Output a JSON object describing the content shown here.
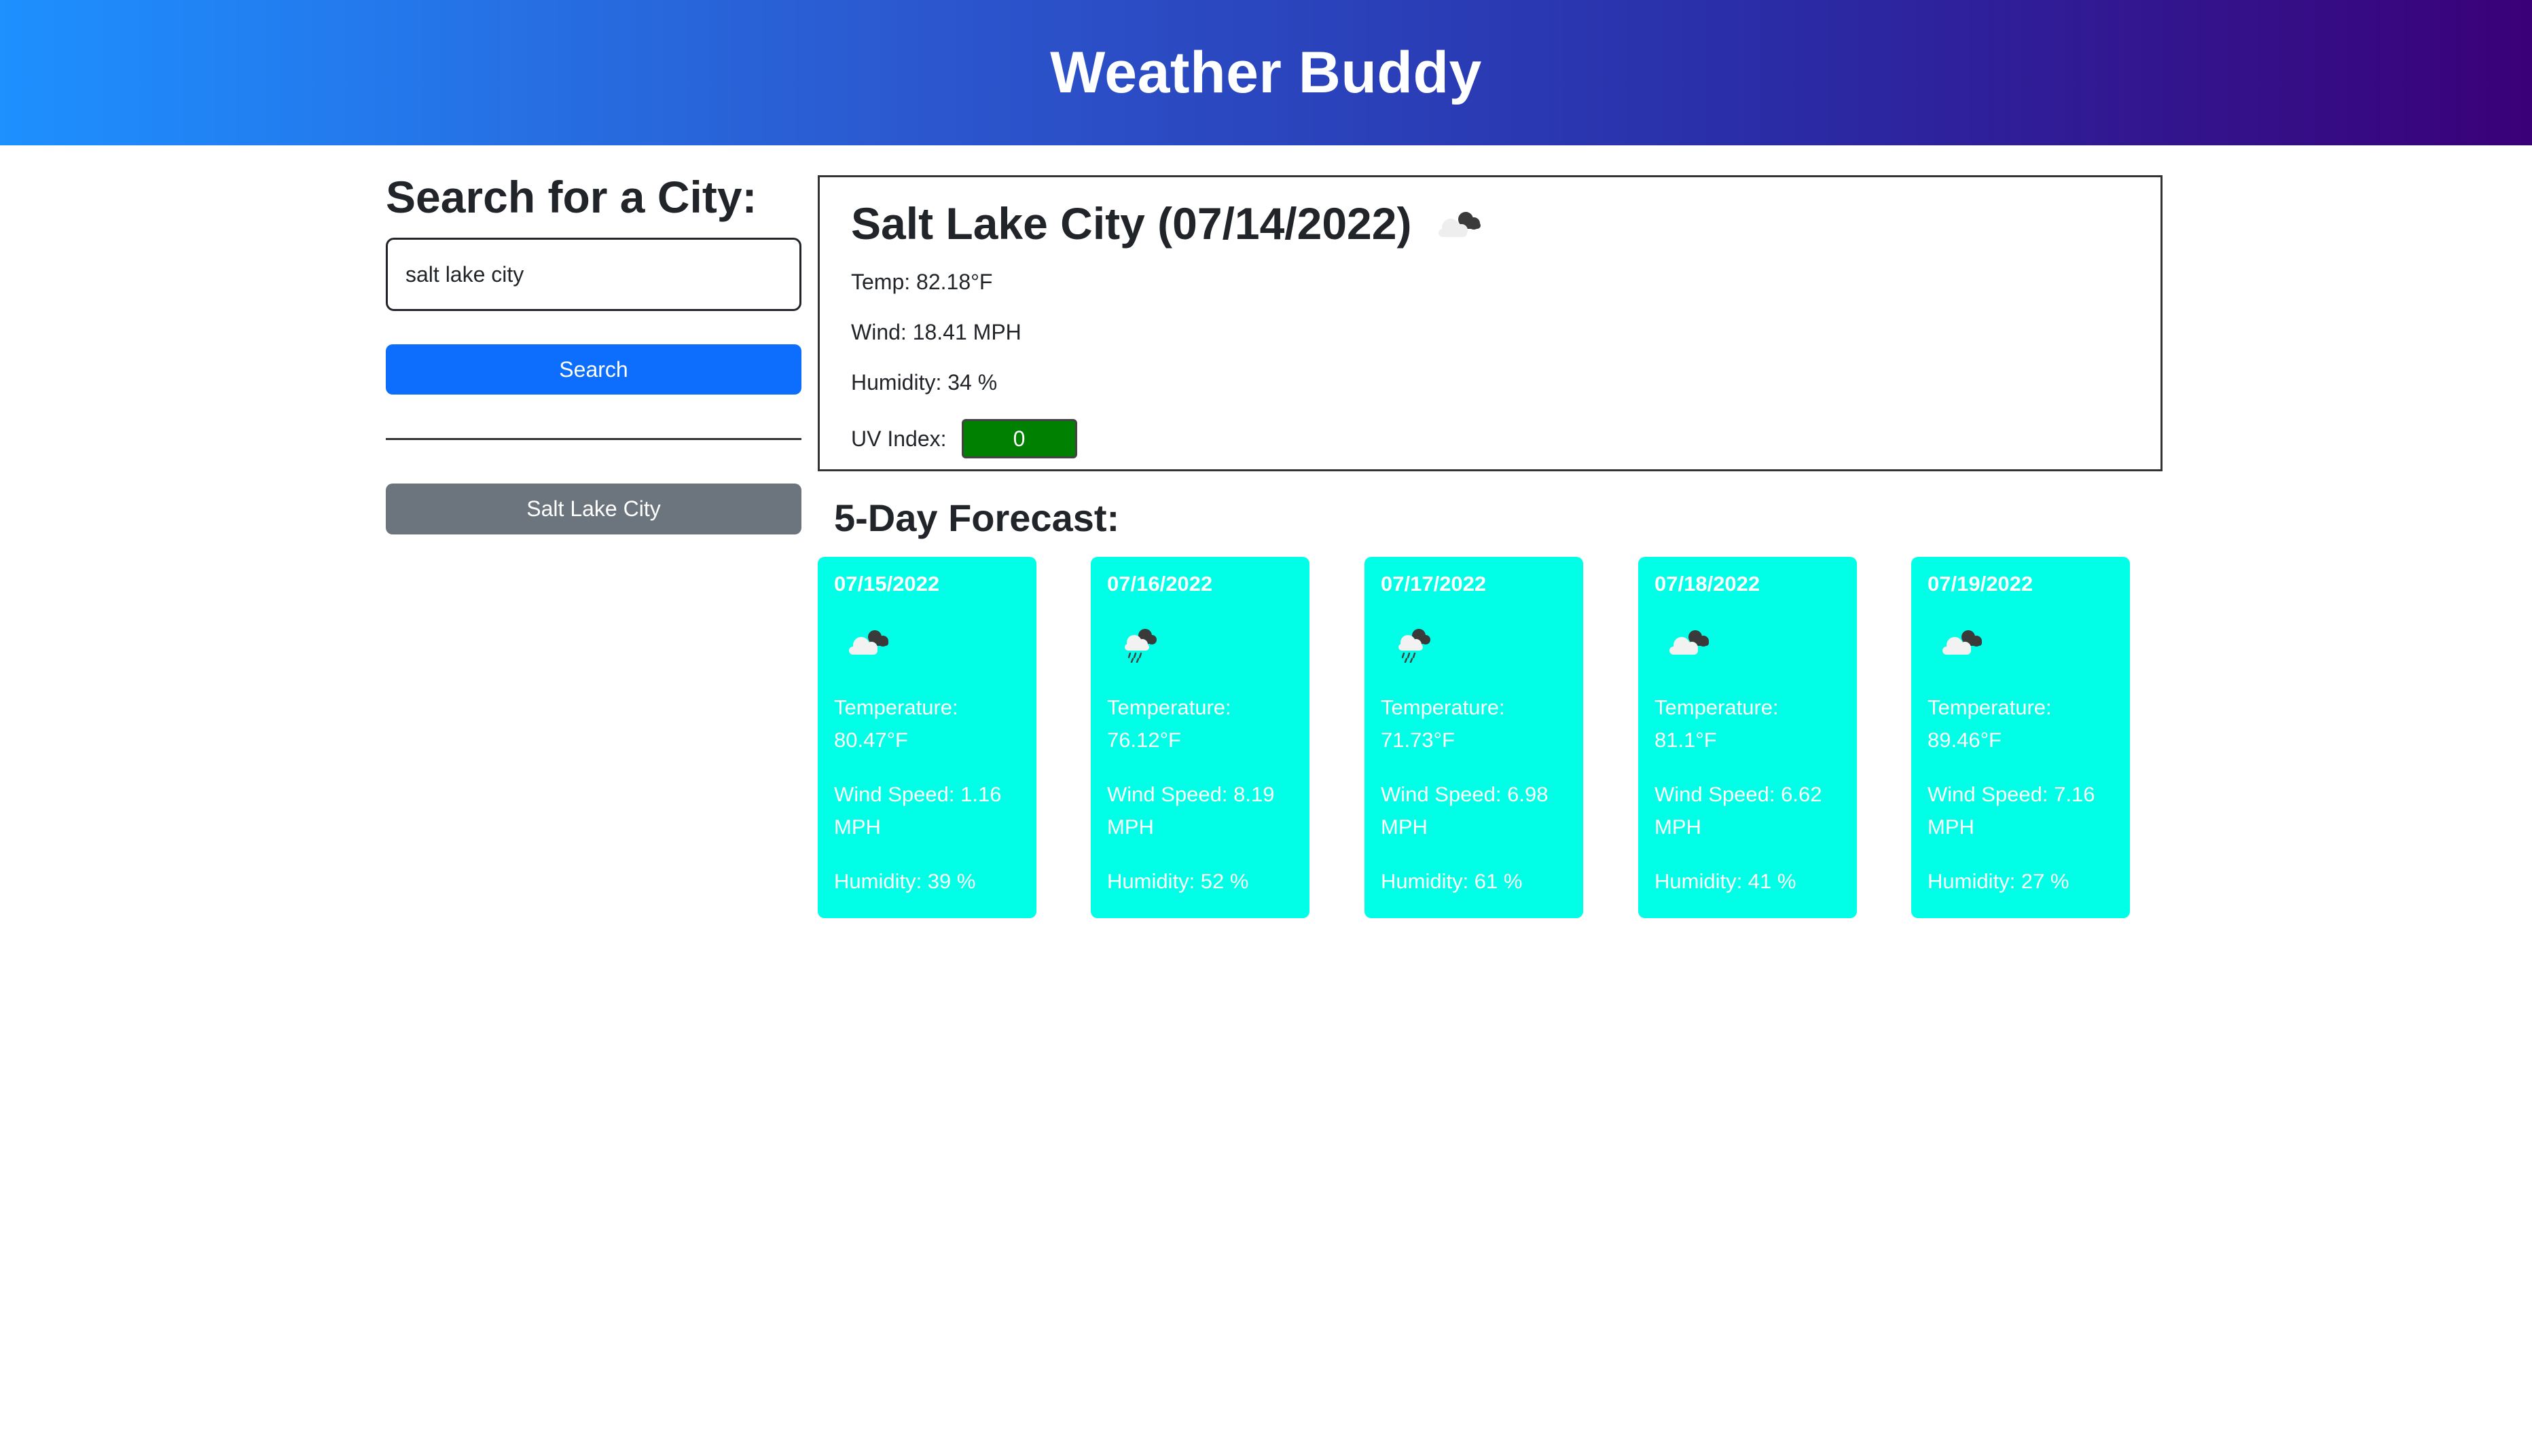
{
  "app": {
    "title": "Weather Buddy"
  },
  "search": {
    "title": "Search for a City:",
    "input_value": "salt lake city",
    "button_label": "Search"
  },
  "history": [
    "Salt Lake City"
  ],
  "current": {
    "title": "Salt Lake City (07/14/2022)",
    "icon": "cloudy-icon",
    "temp": "Temp: 82.18°F",
    "wind": "Wind: 18.41 MPH",
    "humidity": "Humidity: 34 %",
    "uv_label": "UV Index:",
    "uv_value": "0",
    "uv_color": "#008000"
  },
  "forecast": {
    "title": "5-Day Forecast:",
    "card_color": "#00ffe6",
    "days": [
      {
        "date": "07/15/2022",
        "icon": "cloudy-icon",
        "temp": "Temperature: 80.47°F",
        "wind": "Wind Speed: 1.16 MPH",
        "humidity": "Humidity: 39 %"
      },
      {
        "date": "07/16/2022",
        "icon": "rain-icon",
        "temp": "Temperature: 76.12°F",
        "wind": "Wind Speed: 8.19 MPH",
        "humidity": "Humidity: 52 %"
      },
      {
        "date": "07/17/2022",
        "icon": "rain-icon",
        "temp": "Temperature: 71.73°F",
        "wind": "Wind Speed: 6.98 MPH",
        "humidity": "Humidity: 61 %"
      },
      {
        "date": "07/18/2022",
        "icon": "cloudy-icon",
        "temp": "Temperature: 81.1°F",
        "wind": "Wind Speed: 6.62 MPH",
        "humidity": "Humidity: 41 %"
      },
      {
        "date": "07/19/2022",
        "icon": "cloudy-icon",
        "temp": "Temperature: 89.46°F",
        "wind": "Wind Speed: 7.16 MPH",
        "humidity": "Humidity: 27 %"
      }
    ]
  }
}
